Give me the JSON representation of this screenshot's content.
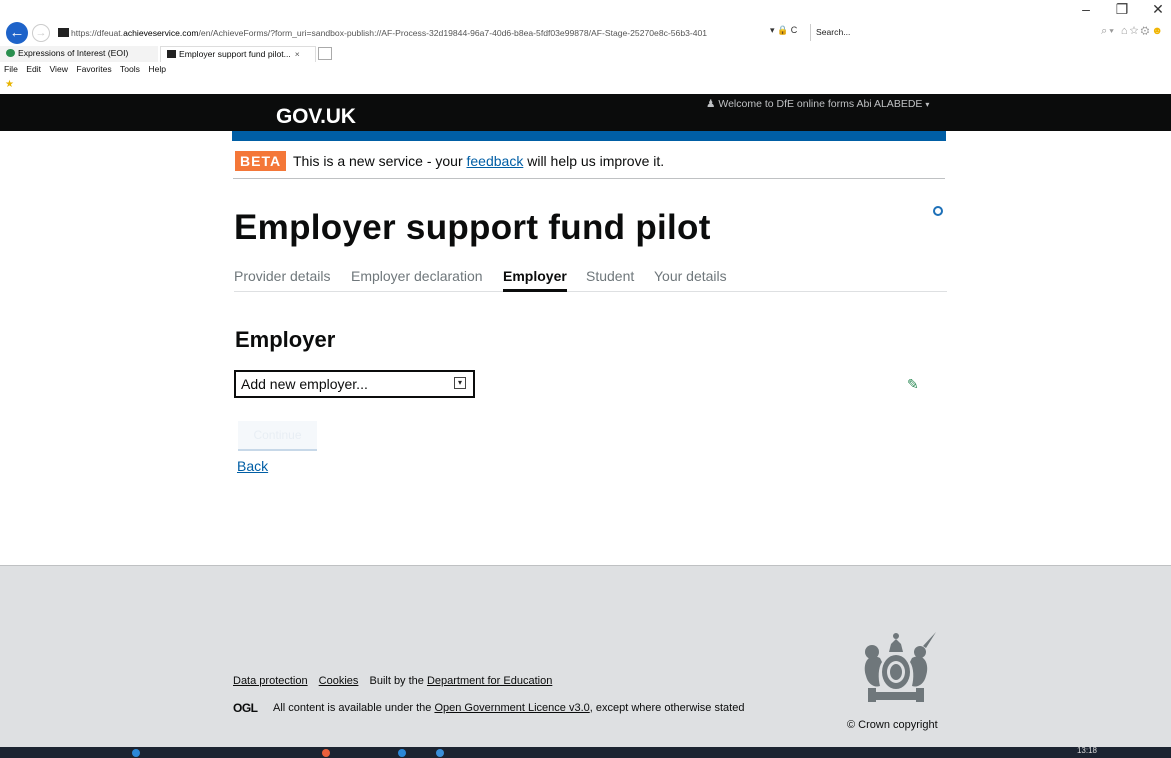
{
  "browser": {
    "window_controls": [
      "–",
      "❐",
      "✕"
    ],
    "back_glyph": "←",
    "forward_glyph": "→",
    "url_prefix": "https://dfeuat.",
    "url_domain": "achieveservice.com",
    "url_rest": "/en/AchieveForms/?form_uri=sandbox-publish://AF-Process-32d19844-96a7-40d6-b8ea-5fdf03e99878/AF-Stage-25270e8c-56b3-401",
    "addr_icons": "▾ 🔒 C",
    "search_text": "Search...",
    "right_icons": "⌕▾ ⌂☆⚙",
    "smile": "☻",
    "tabs": [
      {
        "label": "Expressions of Interest (EOI)"
      },
      {
        "label": "Employer support fund pilot...",
        "close": "×"
      }
    ],
    "menu": [
      "File",
      "Edit",
      "View",
      "Favorites",
      "Tools",
      "Help"
    ],
    "fav_star": "★"
  },
  "header": {
    "logo": "GOV.UK",
    "welcome": "Welcome to DfE online forms Abi ALABEDE",
    "welcome_icon": "♟",
    "caret": "▾"
  },
  "phase_banner": {
    "tag": "BETA",
    "text_before": "This is a new service - your ",
    "link": "feedback",
    "text_after": " will help us improve it."
  },
  "page": {
    "title": "Employer support fund pilot",
    "steps": [
      "Provider details",
      "Employer declaration",
      "Employer",
      "Student",
      "Your details"
    ],
    "active_step": "Employer",
    "section_heading": "Employer",
    "select_value": "Add new employer...",
    "select_arrow": "▾",
    "edit_icon": "✎",
    "continue_label": "Continue",
    "back_link": "Back"
  },
  "footer": {
    "links": [
      "Data protection",
      "Cookies"
    ],
    "built_by_prefix": "Built by the ",
    "built_by_link": "Department for Education",
    "ogl_logo": "OGL",
    "ogl_prefix": "All content is available under the ",
    "ogl_link": "Open Government Licence v3.0",
    "ogl_suffix": ", except where otherwise stated",
    "crown_copyright": "© Crown copyright"
  },
  "taskbar": {
    "clock": "13:18"
  },
  "colors": {
    "gov_black": "#0b0c0c",
    "gov_blue": "#005ea5",
    "beta_orange": "#f47738",
    "footer_grey": "#dee0e2"
  }
}
